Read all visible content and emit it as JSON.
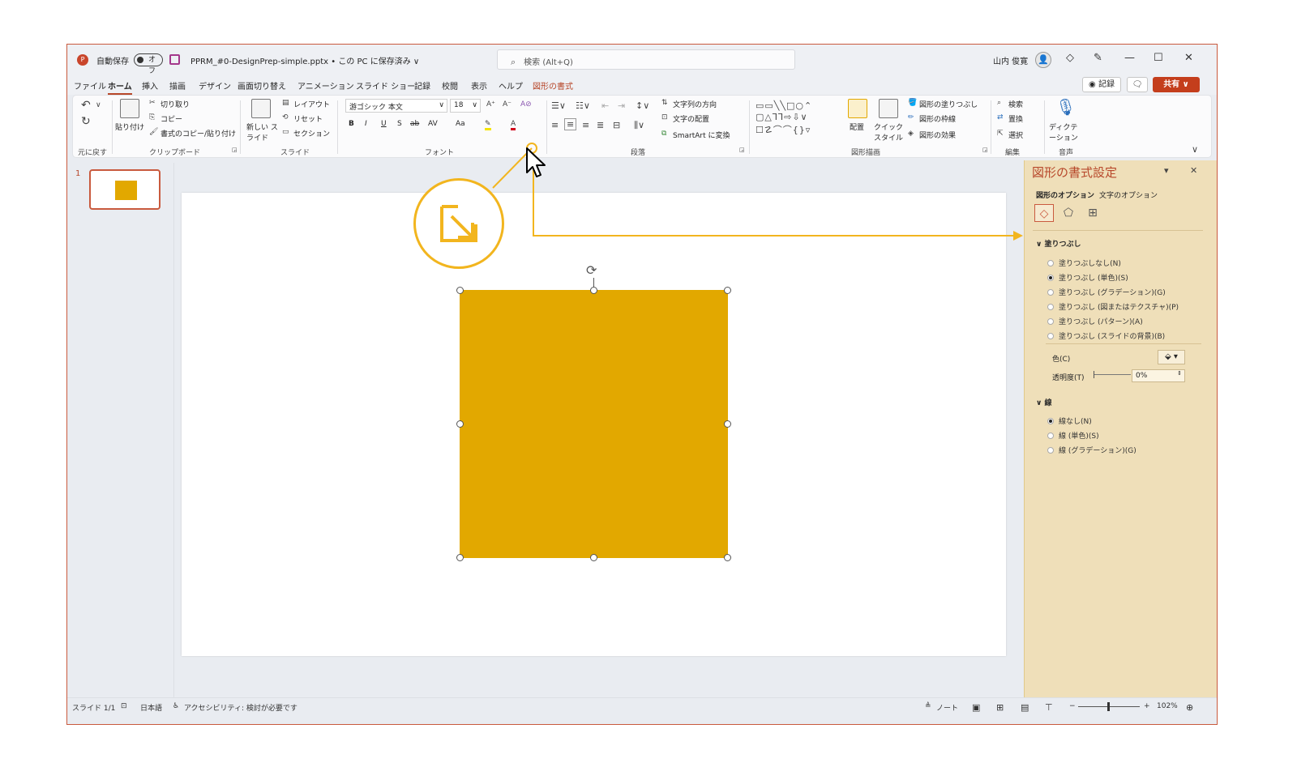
{
  "titlebar": {
    "app_icon": "P",
    "autosave_label": "自動保存",
    "autosave_state": "オフ",
    "file_title": "PPRM_#0-DesignPrep-simple.pptx • この PC に保存済み ∨",
    "search_placeholder": "検索 (Alt+Q)",
    "user_name": "山内 俊寛",
    "icons": [
      "diamond-icon",
      "pen-icon",
      "minimize-icon",
      "restore-icon",
      "close-icon"
    ]
  },
  "menu": {
    "tabs": [
      "ファイル",
      "ホーム",
      "挿入",
      "描画",
      "デザイン",
      "画面切り替え",
      "アニメーション",
      "スライド ショー",
      "記録",
      "校閲",
      "表示",
      "ヘルプ",
      "図形の書式"
    ],
    "active_tab": "ホーム",
    "record_label": "◉ 記録",
    "share_label": "共有"
  },
  "ribbon": {
    "groups": {
      "undo": "元に戻す",
      "clipboard": "クリップボード",
      "slides": "スライド",
      "font": "フォント",
      "paragraph": "段落",
      "drawing": "図形描画",
      "editing": "編集",
      "voice": "音声"
    },
    "clipboard": {
      "paste": "貼り付け",
      "cut": "切り取り",
      "copy": "コピー",
      "format_painter": "書式のコピー/貼り付け"
    },
    "slides": {
      "new_slide": "新しい スライド",
      "layout": "レイアウト",
      "reset": "リセット",
      "section": "セクション"
    },
    "font": {
      "font_name": "游ゴシック 本文",
      "font_size": "18",
      "bold": "B",
      "italic": "I",
      "underline": "U",
      "shadow": "S",
      "strike": "ab",
      "spacing": "AV",
      "case": "Aa"
    },
    "paragraph": {
      "text_direction": "文字列の方向",
      "align_text": "文字の配置",
      "smartart": "SmartArt に変換"
    },
    "drawing": {
      "arrange": "配置",
      "quick_style": "クイック スタイル",
      "shape_fill": "図形の塗りつぶし",
      "shape_outline": "図形の枠線",
      "shape_effects": "図形の効果"
    },
    "editing": {
      "find": "検索",
      "replace": "置換",
      "select": "選択"
    },
    "voice": {
      "dictate": "ディクテーション"
    }
  },
  "thumbnails": {
    "slide_number": "1"
  },
  "format_pane": {
    "title": "図形の書式設定",
    "tabs": [
      "図形のオプション",
      "文字のオプション"
    ],
    "fill_section": "塗りつぶし",
    "fill_options": [
      "塗りつぶしなし(N)",
      "塗りつぶし (単色)(S)",
      "塗りつぶし (グラデーション)(G)",
      "塗りつぶし (図またはテクスチャ)(P)",
      "塗りつぶし (パターン)(A)",
      "塗りつぶし (スライドの背景)(B)"
    ],
    "fill_selected_index": 1,
    "color_label": "色(C)",
    "transparency_label": "透明度(T)",
    "transparency_value": "0%",
    "line_section": "線",
    "line_options": [
      "線なし(N)",
      "線 (単色)(S)",
      "線 (グラデーション)(G)"
    ],
    "line_selected_index": 0
  },
  "statusbar": {
    "slide_info": "スライド 1/1",
    "language": "日本語",
    "accessibility": "アクセシビリティ: 検討が必要です",
    "notes": "ノート",
    "zoom_level": "102%"
  },
  "colors": {
    "shape_fill": "#e2a800",
    "accent": "#b7472a",
    "annotation": "#f2b51e",
    "pane_bg": "#efdfb9"
  }
}
